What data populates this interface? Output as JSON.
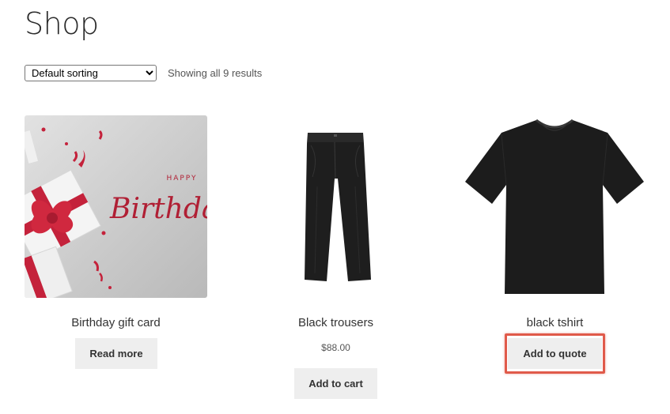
{
  "page": {
    "title": "Shop"
  },
  "toolbar": {
    "sort_selected": "Default sorting",
    "sort_options": [
      "Default sorting"
    ],
    "result_count": "Showing all 9 results"
  },
  "products": [
    {
      "title": "Birthday gift card",
      "price": "",
      "button_label": "Read more",
      "image_text": "HAPPY Birthday"
    },
    {
      "title": "Black trousers",
      "price": "$88.00",
      "button_label": "Add to cart"
    },
    {
      "title": "black tshirt",
      "price": "",
      "button_label": "Add to quote"
    }
  ],
  "colors": {
    "highlight_border": "#e05a4a",
    "button_bg": "#eeeeee",
    "gift_ribbon": "#c4223b"
  }
}
